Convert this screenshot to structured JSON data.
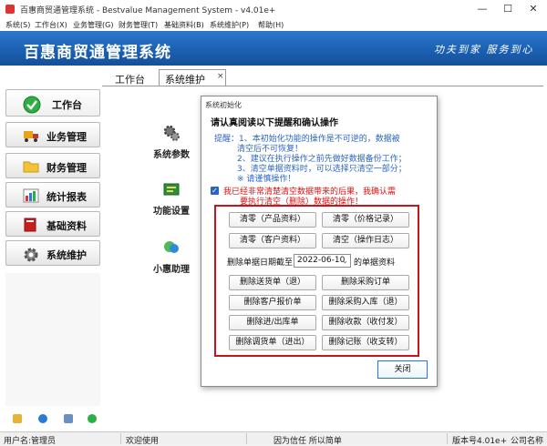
{
  "window": {
    "title": "百惠商贸通管理系统 - Bestvalue Management System - v4.01e+",
    "minimize": "—",
    "maximize": "☐",
    "close": "✕"
  },
  "menu": [
    "系统(S)",
    "工作台(X)",
    "业务管理(G)",
    "财务管理(T)",
    "基础资料(B)",
    "系统维护(P)",
    "帮助(H)"
  ],
  "banner": {
    "app_name": "百惠商贸通管理系统",
    "slogan": "功夫到家 服务到心"
  },
  "sidebar": {
    "items": [
      {
        "label": "工作台",
        "icon": "check-icon"
      },
      {
        "label": "业务管理",
        "icon": "truck-icon"
      },
      {
        "label": "财务管理",
        "icon": "folder-icon"
      },
      {
        "label": "统计报表",
        "icon": "chart-icon"
      },
      {
        "label": "基础资料",
        "icon": "book-icon"
      },
      {
        "label": "系统维护",
        "icon": "gear-icon"
      }
    ]
  },
  "tabs": {
    "workbench": "工作台",
    "settings": "系统维护",
    "close": "×"
  },
  "work_items": [
    {
      "label": "系统参数",
      "icon": "gears-icon"
    },
    {
      "label": "功能设置",
      "icon": "tools-icon"
    },
    {
      "label": "小惠助理",
      "icon": "chat-icon"
    }
  ],
  "dialog": {
    "title": "系统初始化",
    "heading": "请认真阅读以下提醒和确认操作",
    "warning_lines": [
      "提醒：1、本初始化功能的操作是不可逆的，数据被",
      "清空后不可恢复！",
      "2、建议在执行操作之前先做好数据备份工作；",
      "3、清空单据资料时，可以选择只清空一部分；",
      "※ 请谨慎操作！"
    ],
    "confirm_checked": "✓",
    "confirm_lines": [
      "我已经非常清楚清空数据带来的后果，我确认需",
      "要执行清空（删除）数据的操作！"
    ],
    "buttons_top": [
      "清零（产品资料）",
      "清零（价格记录）",
      "清零（客户资料）",
      "清空（操作日志）"
    ],
    "date_prefix": "删除单据日期截至",
    "date_value": "2022-06-10",
    "date_suffix": "的单据资料",
    "buttons_bottom": [
      "删除送货单（退）",
      "删除采购订单",
      "删除客户报价单",
      "删除采购入库（退）",
      "删除进/出库单",
      "删除收款（收付发）",
      "删除调货单（进出）",
      "删除记账（收支转）"
    ],
    "close_label": "关闭"
  },
  "status": {
    "user": "用户名:管理员",
    "welcome": "欢迎使用",
    "motto": "因为信任 所以简单",
    "version": "版本号4.01e+",
    "company": "公司名称"
  }
}
